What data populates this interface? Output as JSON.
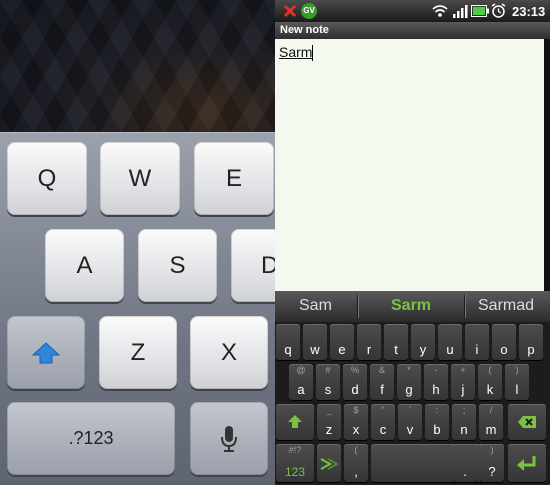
{
  "left_keyboard": {
    "row1": [
      "Q",
      "W",
      "E"
    ],
    "row2": [
      "A",
      "S",
      "D"
    ],
    "row3": [
      "Z",
      "X"
    ],
    "numbers_key": ".?123"
  },
  "status_bar": {
    "time": "23:13",
    "gv_badge": "GV"
  },
  "title_bar": {
    "title": "New note"
  },
  "editor": {
    "text": "Sarm"
  },
  "suggestions": {
    "items": [
      "Sam",
      "Sarm",
      "Sarmad"
    ],
    "selected_color": "#7bc142"
  },
  "android_keyboard": {
    "row1": [
      {
        "main": "q",
        "alt": ""
      },
      {
        "main": "w",
        "alt": ""
      },
      {
        "main": "e",
        "alt": ""
      },
      {
        "main": "r",
        "alt": ""
      },
      {
        "main": "t",
        "alt": ""
      },
      {
        "main": "y",
        "alt": ""
      },
      {
        "main": "u",
        "alt": ""
      },
      {
        "main": "i",
        "alt": ""
      },
      {
        "main": "o",
        "alt": ""
      },
      {
        "main": "p",
        "alt": ""
      }
    ],
    "row2": [
      {
        "main": "a",
        "alt": "@"
      },
      {
        "main": "s",
        "alt": "#"
      },
      {
        "main": "d",
        "alt": "%"
      },
      {
        "main": "f",
        "alt": "&"
      },
      {
        "main": "g",
        "alt": "*"
      },
      {
        "main": "h",
        "alt": "-"
      },
      {
        "main": "j",
        "alt": "+"
      },
      {
        "main": "k",
        "alt": "("
      },
      {
        "main": "l",
        "alt": ")"
      }
    ],
    "row3": [
      {
        "main": "z",
        "alt": "_"
      },
      {
        "main": "x",
        "alt": "$"
      },
      {
        "main": "c",
        "alt": "\""
      },
      {
        "main": "v",
        "alt": "'"
      },
      {
        "main": "b",
        "alt": ":"
      },
      {
        "main": "n",
        "alt": ";"
      },
      {
        "main": "m",
        "alt": "/"
      }
    ],
    "row4": {
      "symbols_label": "123",
      "symbols_alt": "#!?",
      "comma_main": ",",
      "comma_alt": "(",
      "period_main": ".",
      "period_alt": "",
      "question_main": "?",
      "question_alt": ")"
    }
  },
  "colors": {
    "accent_green": "#7bc142",
    "ios_blue": "#2e86de"
  }
}
